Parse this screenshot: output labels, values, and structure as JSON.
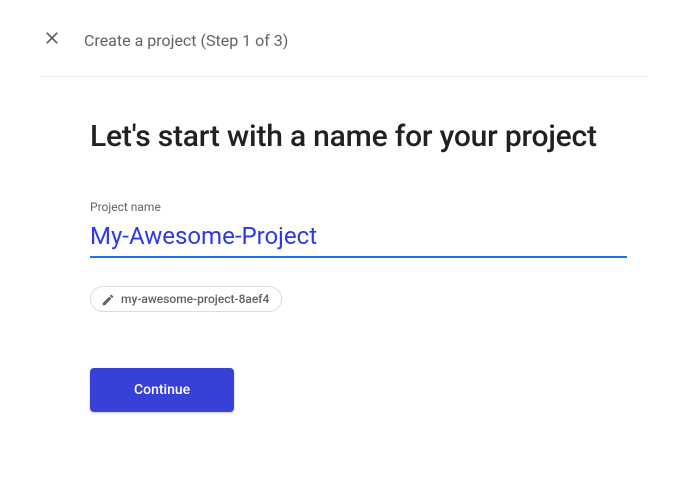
{
  "header": {
    "title": "Create a project (Step 1 of 3)"
  },
  "main": {
    "heading": "Let's start with a name for your project",
    "field_label": "Project name",
    "project_name_value": "My-Awesome-Project",
    "project_id_chip": "my-awesome-project-8aef4"
  },
  "buttons": {
    "continue": "Continue"
  }
}
